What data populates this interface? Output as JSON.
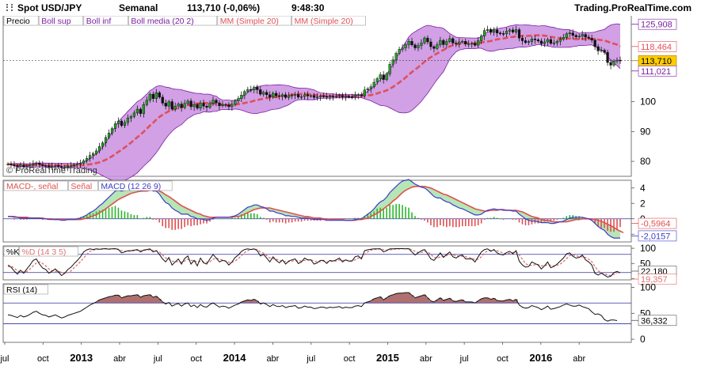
{
  "header": {
    "instrument": "Spot USD/JPY",
    "period": "Semanal",
    "quote": "113,710 (-0,06%)",
    "time": "9:48:30",
    "brand": "Trading.ProRealTime.com",
    "watermark": "© ProRealTime Trading"
  },
  "colors": {
    "up_candle": "#1fa31f",
    "down_candle": "#111111",
    "bollinger_fill": "#c98fe0",
    "bollinger_line": "#7b1fa2",
    "mm": "#e0505a",
    "macd_line": "#3c3cc8",
    "signal_line": "#e05050",
    "hist_pos": "#2db82d",
    "hist_neg": "#e05050",
    "stoch_k": "#111111",
    "stoch_d": "#e07070",
    "rsi_line": "#111111",
    "rsi_fill": "#b07070",
    "level_line": "#3030a0",
    "price_tag": "#ffcc00"
  },
  "chart_data": [
    {
      "type": "candlestick",
      "title": "Precio",
      "legend": [
        "Precio",
        "Boll sup",
        "Boll inf",
        "Boll media (20 2)",
        "MM (Simple 20)",
        "MM (Simple 20)"
      ],
      "x_ticks": [
        "jul",
        "oct",
        "2013",
        "abr",
        "jul",
        "oct",
        "2014",
        "abr",
        "jul",
        "oct",
        "2015",
        "abr",
        "jul",
        "oct",
        "2016",
        "abr"
      ],
      "y_ticks": [
        80,
        90,
        100
      ],
      "ylim": [
        75,
        129
      ],
      "tags": [
        "125,908",
        "118,464",
        "113,710",
        "111,021"
      ],
      "last": 113.71,
      "boll_sup": 125.908,
      "mm": 118.464,
      "boll_inf": 111.021,
      "closes": [
        79.1,
        78.9,
        78.6,
        78.4,
        78.8,
        78.2,
        78.5,
        78.8,
        79.2,
        79.4,
        78.9,
        78.6,
        78.5,
        78.2,
        78.4,
        78.6,
        78.3,
        77.9,
        78.1,
        78.4,
        78.6,
        78.9,
        79.1,
        79.4,
        80.2,
        81.0,
        82.0,
        82.6,
        83.5,
        85.0,
        86.2,
        88.0,
        89.5,
        91.0,
        92.6,
        93.5,
        92.0,
        93.0,
        94.5,
        95.0,
        96.2,
        97.5,
        96.0,
        99.0,
        100.5,
        102.5,
        101.0,
        103.0,
        101.5,
        99.5,
        98.5,
        100.0,
        97.5,
        98.5,
        99.2,
        98.0,
        99.4,
        100.2,
        98.3,
        99.0,
        97.8,
        99.5,
        98.5,
        98.1,
        99.4,
        100.5,
        99.6,
        98.6,
        99.0,
        98.9,
        98.3,
        99.1,
        100.2,
        101.0,
        102.2,
        103.4,
        104.1,
        103.9,
        104.8,
        104.0,
        102.5,
        103.1,
        102.3,
        101.5,
        102.8,
        102.0,
        101.8,
        102.3,
        101.4,
        102.0,
        102.2,
        102.4,
        101.5,
        101.7,
        102.3,
        101.9,
        102.0,
        101.4,
        101.6,
        101.9,
        101.8,
        101.5,
        101.8,
        101.7,
        101.9,
        102.1,
        101.6,
        101.8,
        101.7,
        101.6,
        102.2,
        102.3,
        102.0,
        103.9,
        104.3,
        105.0,
        106.5,
        107.7,
        109.0,
        107.4,
        109.3,
        112.5,
        114.0,
        116.2,
        117.5,
        118.0,
        119.1,
        120.2,
        119.0,
        118.0,
        118.8,
        119.7,
        121.3,
        120.0,
        118.4,
        117.8,
        119.0,
        120.5,
        119.1,
        120.1,
        121.1,
        119.6,
        119.4,
        120.0,
        120.2,
        119.3,
        119.4,
        119.5,
        118.9,
        120.4,
        122.0,
        123.8,
        124.2,
        123.2,
        124.0,
        123.0,
        122.8,
        122.7,
        123.6,
        124.0,
        123.3,
        124.1,
        121.3,
        120.4,
        119.8,
        120.1,
        121.0,
        120.7,
        120.3,
        119.4,
        120.0,
        120.8,
        119.5,
        119.7,
        120.2,
        120.9,
        121.5,
        122.7,
        123.0,
        122.2,
        121.7,
        121.9,
        122.5,
        121.6,
        121.2,
        120.6,
        118.4,
        117.0,
        117.2,
        116.5,
        113.1,
        112.2,
        113.6,
        113.9,
        113.7
      ]
    },
    {
      "type": "line",
      "title": "MACD (12 26 9)",
      "legend": [
        "MACD-, señal",
        "Señal",
        "MACD (12 26 9)"
      ],
      "y_ticks": [
        -2,
        0,
        2,
        4
      ],
      "ylim": [
        -3,
        5
      ],
      "tags": [
        "-0,5964",
        "-2,0157"
      ],
      "macd_last": -2.0157,
      "signal_last": -0.5964,
      "macd": [
        0.3,
        0.3,
        0.2,
        0.2,
        0.1,
        0.1,
        0.1,
        0.1,
        0.1,
        0.1,
        0.1,
        0.0,
        0.0,
        -0.1,
        -0.1,
        -0.1,
        -0.1,
        -0.2,
        -0.2,
        -0.1,
        -0.1,
        -0.1,
        0.0,
        0.1,
        0.3,
        0.5,
        0.8,
        1.0,
        1.3,
        1.7,
        2.0,
        2.4,
        2.8,
        3.2,
        3.6,
        3.7,
        3.6,
        3.7,
        3.8,
        3.8,
        3.8,
        3.9,
        3.6,
        3.7,
        3.8,
        3.9,
        3.6,
        3.6,
        3.2,
        2.6,
        2.1,
        1.9,
        1.4,
        1.1,
        0.9,
        0.6,
        0.6,
        0.6,
        0.3,
        0.2,
        0.0,
        0.0,
        -0.1,
        -0.2,
        -0.1,
        0.1,
        0.2,
        0.2,
        0.2,
        0.2,
        0.2,
        0.3,
        0.4,
        0.6,
        0.9,
        1.2,
        1.5,
        1.6,
        1.8,
        1.8,
        1.6,
        1.5,
        1.3,
        1.0,
        1.0,
        0.8,
        0.7,
        0.6,
        0.4,
        0.4,
        0.3,
        0.3,
        0.2,
        0.1,
        0.1,
        0.1,
        0.0,
        -0.1,
        -0.1,
        -0.1,
        -0.1,
        -0.2,
        -0.2,
        -0.2,
        -0.2,
        -0.2,
        -0.2,
        -0.2,
        -0.2,
        -0.2,
        -0.1,
        0.0,
        0.0,
        0.3,
        0.6,
        0.9,
        1.3,
        1.8,
        2.2,
        2.4,
        2.8,
        3.4,
        3.8,
        4.2,
        4.6,
        4.9,
        5.0,
        5.1,
        4.8,
        4.5,
        4.3,
        4.1,
        4.0,
        3.7,
        3.3,
        2.9,
        2.7,
        2.7,
        2.4,
        2.2,
        2.1,
        1.8,
        1.6,
        1.4,
        1.3,
        1.1,
        0.9,
        0.7,
        0.5,
        0.5,
        0.6,
        0.9,
        1.1,
        1.2,
        1.3,
        1.2,
        1.2,
        1.1,
        1.1,
        1.1,
        1.0,
        1.0,
        0.6,
        0.3,
        0.0,
        -0.2,
        -0.3,
        -0.3,
        -0.4,
        -0.5,
        -0.5,
        -0.5,
        -0.6,
        -0.6,
        -0.5,
        -0.4,
        -0.3,
        -0.1,
        0.1,
        0.2,
        0.2,
        0.2,
        0.2,
        0.1,
        0.0,
        -0.2,
        -0.6,
        -1.0,
        -1.3,
        -1.5,
        -2.0,
        -2.3,
        -2.5,
        -2.5,
        -2.5
      ],
      "signal": [
        0.3,
        0.3,
        0.3,
        0.2,
        0.2,
        0.2,
        0.2,
        0.1,
        0.1,
        0.1,
        0.1,
        0.1,
        0.0,
        0.0,
        0.0,
        -0.1,
        -0.1,
        -0.1,
        -0.1,
        -0.1,
        -0.1,
        -0.1,
        -0.1,
        -0.1,
        0.0,
        0.1,
        0.2,
        0.4,
        0.5,
        0.8,
        1.0,
        1.3,
        1.6,
        1.9,
        2.2,
        2.5,
        2.7,
        2.9,
        3.1,
        3.3,
        3.4,
        3.5,
        3.6,
        3.6,
        3.6,
        3.7,
        3.7,
        3.7,
        3.6,
        3.4,
        3.1,
        2.9,
        2.6,
        2.3,
        2.0,
        1.7,
        1.5,
        1.3,
        1.1,
        0.9,
        0.7,
        0.6,
        0.4,
        0.3,
        0.2,
        0.2,
        0.2,
        0.2,
        0.2,
        0.2,
        0.2,
        0.2,
        0.3,
        0.3,
        0.4,
        0.6,
        0.8,
        1.0,
        1.2,
        1.3,
        1.4,
        1.4,
        1.4,
        1.4,
        1.3,
        1.2,
        1.1,
        1.0,
        0.9,
        0.8,
        0.7,
        0.6,
        0.5,
        0.4,
        0.3,
        0.3,
        0.2,
        0.1,
        0.1,
        0.1,
        0.0,
        0.0,
        -0.1,
        -0.1,
        -0.1,
        -0.1,
        -0.1,
        -0.2,
        -0.2,
        -0.2,
        -0.2,
        -0.1,
        -0.1,
        0.0,
        0.1,
        0.3,
        0.5,
        0.7,
        1.0,
        1.3,
        1.6,
        1.9,
        2.3,
        2.6,
        3.0,
        3.4,
        3.7,
        3.9,
        4.1,
        4.2,
        4.2,
        4.2,
        4.2,
        4.1,
        4.0,
        3.8,
        3.6,
        3.4,
        3.2,
        3.1,
        2.9,
        2.7,
        2.5,
        2.3,
        2.1,
        1.9,
        1.7,
        1.5,
        1.3,
        1.2,
        1.1,
        1.0,
        1.0,
        1.1,
        1.1,
        1.1,
        1.2,
        1.2,
        1.1,
        1.1,
        1.1,
        1.1,
        1.0,
        0.9,
        0.7,
        0.5,
        0.3,
        0.2,
        0.1,
        -0.1,
        -0.2,
        -0.2,
        -0.3,
        -0.4,
        -0.4,
        -0.4,
        -0.4,
        -0.4,
        -0.3,
        -0.2,
        -0.1,
        -0.1,
        0.0,
        0.0,
        0.0,
        0.0,
        -0.1,
        -0.2,
        -0.3,
        -0.5,
        -0.7,
        -0.9,
        -1.1,
        -1.4,
        -1.6,
        -1.8
      ]
    },
    {
      "type": "line",
      "title": "%K (14 3 5)",
      "legend": [
        "%K",
        "%D (14 3 5)"
      ],
      "y_ticks": [
        0,
        50,
        100
      ],
      "ylim": [
        -4,
        108
      ],
      "tags": [
        "22,180",
        "19,357"
      ],
      "k_last": 19.357,
      "d_last": 22.18,
      "k": [
        42,
        38,
        25,
        15,
        28,
        18,
        32,
        45,
        60,
        65,
        48,
        35,
        30,
        18,
        25,
        32,
        22,
        10,
        18,
        30,
        38,
        50,
        60,
        72,
        88,
        95,
        98,
        96,
        98,
        97,
        98,
        99,
        97,
        98,
        99,
        96,
        85,
        88,
        92,
        92,
        94,
        96,
        88,
        94,
        96,
        98,
        88,
        92,
        80,
        65,
        55,
        70,
        45,
        55,
        65,
        48,
        66,
        75,
        48,
        60,
        42,
        68,
        52,
        48,
        65,
        80,
        68,
        55,
        60,
        58,
        45,
        55,
        70,
        78,
        90,
        96,
        98,
        96,
        98,
        92,
        75,
        80,
        68,
        55,
        72,
        60,
        52,
        62,
        48,
        58,
        62,
        65,
        50,
        55,
        68,
        62,
        62,
        48,
        52,
        60,
        60,
        50,
        60,
        58,
        62,
        68,
        55,
        62,
        58,
        58,
        72,
        75,
        65,
        92,
        95,
        97,
        98,
        98,
        98,
        88,
        92,
        98,
        98,
        99,
        99,
        99,
        98,
        99,
        88,
        78,
        85,
        92,
        96,
        82,
        65,
        60,
        72,
        85,
        70,
        80,
        88,
        72,
        68,
        75,
        78,
        65,
        65,
        65,
        55,
        72,
        88,
        96,
        98,
        90,
        96,
        85,
        80,
        78,
        86,
        90,
        82,
        92,
        58,
        45,
        38,
        40,
        55,
        50,
        45,
        32,
        42,
        55,
        36,
        40,
        48,
        58,
        68,
        82,
        85,
        74,
        68,
        70,
        78,
        62,
        55,
        45,
        18,
        12,
        18,
        12,
        5,
        8,
        20,
        24,
        19
      ],
      "d": [
        45,
        42,
        34,
        26,
        22,
        22,
        24,
        32,
        42,
        52,
        55,
        50,
        42,
        32,
        26,
        24,
        25,
        20,
        18,
        20,
        26,
        36,
        46,
        56,
        68,
        80,
        90,
        94,
        96,
        97,
        97,
        98,
        98,
        98,
        98,
        97,
        92,
        90,
        90,
        91,
        92,
        94,
        92,
        93,
        94,
        95,
        93,
        92,
        88,
        78,
        68,
        64,
        58,
        56,
        56,
        54,
        58,
        64,
        60,
        60,
        54,
        58,
        56,
        54,
        56,
        64,
        68,
        64,
        62,
        58,
        54,
        54,
        58,
        66,
        76,
        86,
        92,
        96,
        97,
        96,
        88,
        84,
        76,
        68,
        66,
        64,
        60,
        58,
        56,
        56,
        58,
        60,
        58,
        58,
        60,
        62,
        62,
        58,
        56,
        56,
        58,
        56,
        56,
        58,
        58,
        62,
        60,
        60,
        60,
        58,
        62,
        68,
        70,
        80,
        88,
        94,
        96,
        97,
        98,
        95,
        94,
        95,
        96,
        98,
        98,
        99,
        99,
        99,
        95,
        90,
        86,
        86,
        90,
        88,
        80,
        70,
        68,
        72,
        74,
        76,
        80,
        78,
        76,
        74,
        74,
        72,
        70,
        68,
        62,
        64,
        72,
        84,
        92,
        94,
        94,
        92,
        88,
        84,
        82,
        84,
        86,
        88,
        78,
        64,
        50,
        44,
        44,
        46,
        46,
        42,
        42,
        46,
        44,
        42,
        44,
        48,
        56,
        66,
        76,
        78,
        76,
        72,
        72,
        70,
        64,
        56,
        40,
        26,
        20,
        16,
        12,
        10,
        14,
        20,
        22
      ]
    },
    {
      "type": "line",
      "title": "RSI (14)",
      "legend": [
        "RSI (14)"
      ],
      "y_ticks": [
        0,
        50,
        100
      ],
      "ylim": [
        -6,
        107
      ],
      "overbought": 70,
      "oversold": 30,
      "tags": [
        "36,332"
      ],
      "rsi_last": 36.332,
      "rsi": [
        47,
        46,
        44,
        42,
        46,
        43,
        45,
        48,
        52,
        54,
        50,
        47,
        46,
        43,
        45,
        47,
        44,
        41,
        43,
        46,
        48,
        50,
        52,
        54,
        58,
        62,
        66,
        69,
        72,
        76,
        78,
        80,
        82,
        83,
        85,
        85,
        80,
        82,
        84,
        84,
        85,
        86,
        81,
        84,
        85,
        86,
        81,
        83,
        78,
        72,
        68,
        71,
        64,
        67,
        69,
        64,
        68,
        70,
        63,
        66,
        61,
        67,
        63,
        62,
        67,
        70,
        66,
        62,
        64,
        63,
        60,
        63,
        66,
        68,
        72,
        74,
        76,
        75,
        77,
        74,
        68,
        70,
        67,
        63,
        67,
        64,
        63,
        65,
        61,
        63,
        64,
        65,
        60,
        61,
        64,
        62,
        62,
        59,
        60,
        62,
        62,
        60,
        62,
        61,
        62,
        63,
        60,
        62,
        61,
        61,
        64,
        65,
        63,
        70,
        72,
        74,
        78,
        80,
        82,
        76,
        80,
        84,
        86,
        88,
        89,
        89,
        90,
        90,
        85,
        80,
        82,
        84,
        86,
        80,
        74,
        72,
        76,
        80,
        75,
        77,
        79,
        74,
        73,
        75,
        76,
        72,
        72,
        72,
        70,
        74,
        78,
        80,
        80,
        77,
        79,
        75,
        74,
        74,
        76,
        77,
        74,
        77,
        66,
        62,
        60,
        61,
        65,
        63,
        61,
        57,
        60,
        64,
        58,
        59,
        61,
        63,
        66,
        68,
        66,
        64,
        64,
        66,
        63,
        61,
        59,
        53,
        48,
        49,
        46,
        38,
        35,
        37,
        37,
        36
      ]
    }
  ]
}
